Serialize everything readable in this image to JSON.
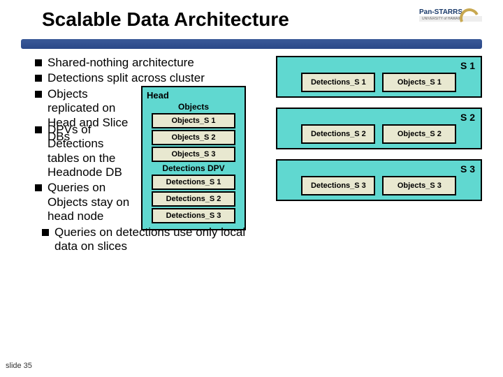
{
  "title": "Scalable Data Architecture",
  "logo": {
    "text": "Pan-STARRS",
    "sub": "UNIVERSITY of HAWAII"
  },
  "bullets": {
    "b1": "Shared-nothing architecture",
    "b2": "Detections split across cluster",
    "b3": "Objects replicated on Head and Slice DBs",
    "b4": "DPVs of Detections tables on the Headnode DB",
    "b5": "Queries on Objects stay on head node",
    "b6": "Queries on detections use only local data on slices"
  },
  "head": {
    "title": "Head",
    "objects_label": "Objects",
    "o1": "Objects_S 1",
    "o2": "Objects_S 2",
    "o3": "Objects_S 3",
    "dpv_label": "Detections DPV",
    "d1": "Detections_S 1",
    "d2": "Detections_S 2",
    "d3": "Detections_S 3"
  },
  "slices": {
    "s1": {
      "label": "S 1",
      "det": "Detections_S 1",
      "obj": "Objects_S 1"
    },
    "s2": {
      "label": "S 2",
      "det": "Detections_S 2",
      "obj": "Objects_S 2"
    },
    "s3": {
      "label": "S 3",
      "det": "Detections_S 3",
      "obj": "Objects_S 3"
    }
  },
  "footer": "slide 35"
}
